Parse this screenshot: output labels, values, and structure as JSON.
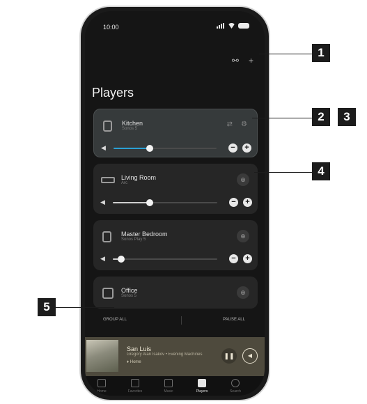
{
  "status_bar": {
    "time": "10:00"
  },
  "header": {
    "title": "Players",
    "top_icons": [
      "group-icon",
      "add-icon"
    ]
  },
  "players": [
    {
      "name": "Kitchen",
      "sub": "Sonos 5",
      "volume": 0.35,
      "selected": true,
      "actions": [
        "reorder-icon",
        "settings-icon"
      ]
    },
    {
      "name": "Living Room",
      "sub": "Arc",
      "volume": 0.35,
      "selected": false
    },
    {
      "name": "Master Bedroom",
      "sub": "Sonos Play 5",
      "volume": 0.08,
      "selected": false
    },
    {
      "name": "Office",
      "sub": "Sonos 5",
      "selected": false
    }
  ],
  "actions": {
    "group_all": "GROUP ALL",
    "pause_all": "PAUSE ALL"
  },
  "now_playing": {
    "title": "San Luis",
    "subtitle": "Gregory Alan Isakov • Evening Machines",
    "room": "Home"
  },
  "tabs": [
    {
      "label": "Home",
      "icon": "home-icon"
    },
    {
      "label": "Favorites",
      "icon": "star-icon"
    },
    {
      "label": "Music",
      "icon": "music-icon"
    },
    {
      "label": "Players",
      "icon": "speaker-icon",
      "active": true
    },
    {
      "label": "Search",
      "icon": "search-icon"
    }
  ],
  "callouts": [
    "1",
    "2",
    "3",
    "4",
    "5"
  ],
  "colors": {
    "accent": "#2aa0d5",
    "card": "#262626",
    "selected_card": "#363a3b",
    "now_playing_bg": "#4e4a3d"
  }
}
